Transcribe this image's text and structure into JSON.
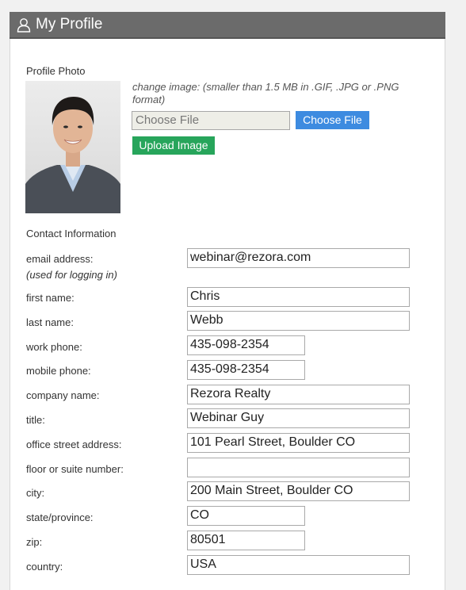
{
  "header": {
    "title": "My Profile",
    "icon": "user-icon"
  },
  "photo_section": {
    "label": "Profile Photo",
    "hint": "change image: (smaller than 1.5 MB in .GIF, .JPG or .PNG format)",
    "file_placeholder": "Choose File",
    "choose_button": "Choose File",
    "upload_button": "Upload Image"
  },
  "contact": {
    "label": "Contact Information",
    "email_label": "email address:",
    "email_sublabel": "(used for logging in)",
    "email_value": "webinar@rezora.com",
    "first_name_label": "first name:",
    "first_name_value": "Chris",
    "last_name_label": "last name:",
    "last_name_value": "Webb",
    "work_phone_label": "work phone:",
    "work_phone_value": "435-098-2354",
    "mobile_phone_label": "mobile phone:",
    "mobile_phone_value": "435-098-2354",
    "company_label": "company name:",
    "company_value": "Rezora Realty",
    "title_label": "title:",
    "title_value": "Webinar Guy",
    "street_label": "office street address:",
    "street_value": "101 Pearl Street, Boulder CO",
    "suite_label": "floor or suite number:",
    "suite_value": "",
    "city_label": "city:",
    "city_value": "200 Main Street, Boulder CO",
    "state_label": "state/province:",
    "state_value": "CO",
    "zip_label": "zip:",
    "zip_value": "80501",
    "country_label": "country:",
    "country_value": "USA"
  },
  "colors": {
    "header_bg": "#6b6b6b",
    "choose_button": "#3d8be0",
    "upload_button": "#27a55b"
  }
}
